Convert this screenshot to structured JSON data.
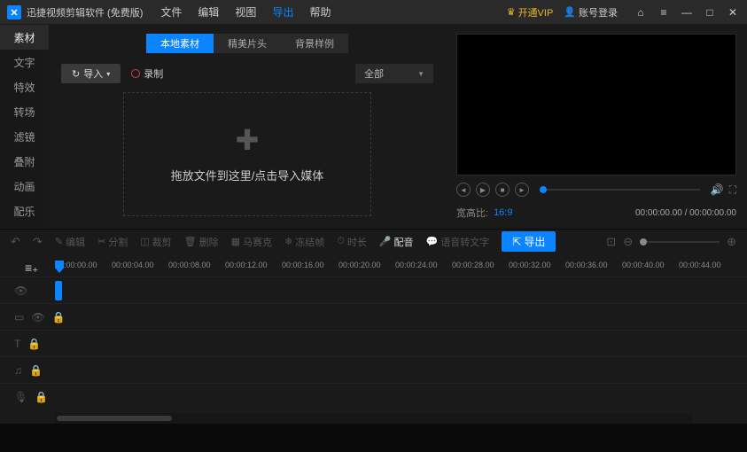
{
  "titlebar": {
    "app_name": "迅捷视频剪辑软件 (免费版)",
    "menus": [
      "文件",
      "编辑",
      "视图",
      "导出",
      "帮助"
    ],
    "vip_label": "开通VIP",
    "login_label": "账号登录"
  },
  "sidebar": {
    "items": [
      "素材",
      "文字",
      "特效",
      "转场",
      "滤镜",
      "叠附",
      "动画",
      "配乐"
    ]
  },
  "center": {
    "tabs": [
      "本地素材",
      "精美片头",
      "背景样例"
    ],
    "import_label": "导入",
    "record_label": "录制",
    "category_label": "全部",
    "dropzone_text": "拖放文件到这里/点击导入媒体"
  },
  "preview": {
    "aspect_label": "宽高比:",
    "aspect_value": "16:9",
    "timecode": "00:00:00.00 / 00:00:00.00"
  },
  "toolbar": {
    "edit": "编辑",
    "split": "分割",
    "crop": "裁剪",
    "delete": "删除",
    "mosaic": "马赛克",
    "freeze": "冻结帧",
    "duration": "时长",
    "audio": "配音",
    "speech": "语音转文字",
    "export": "导出"
  },
  "timeline": {
    "ticks": [
      "00:00:00.00",
      "00:00:04.00",
      "00:00:08.00",
      "00:00:12.00",
      "00:00:16.00",
      "00:00:20.00",
      "00:00:24.00",
      "00:00:28.00",
      "00:00:32.00",
      "00:00:36.00",
      "00:00:40.00",
      "00:00:44.00"
    ]
  }
}
